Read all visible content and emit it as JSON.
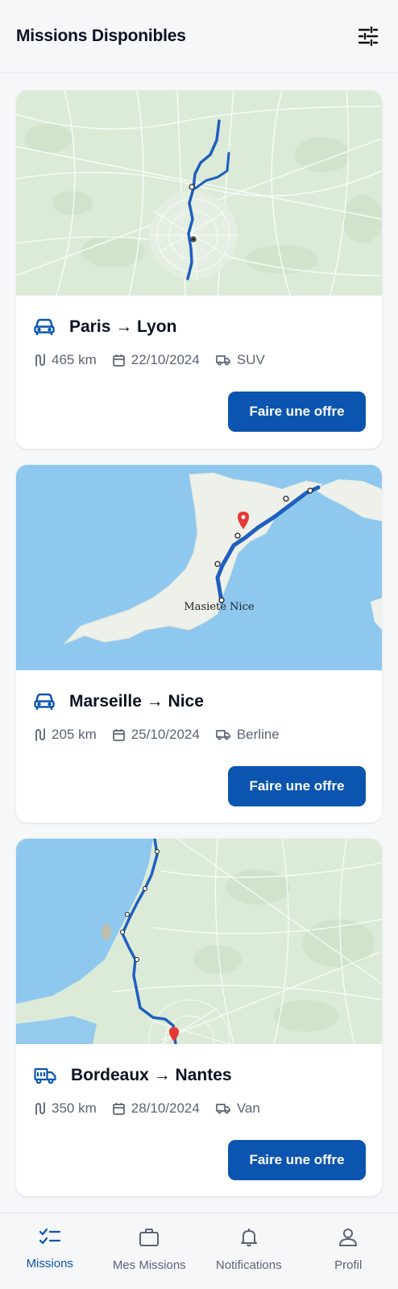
{
  "header": {
    "title": "Missions Disponibles",
    "filter_icon": "sliders-icon"
  },
  "missions": [
    {
      "route": "Paris → Lyon",
      "distance": "465 km",
      "date": "22/10/2024",
      "vehicle": "SUV",
      "vehicle_icon": "car-icon",
      "offer_label": "Faire une offre"
    },
    {
      "route": "Marseille → Nice",
      "distance": "205 km",
      "date": "25/10/2024",
      "vehicle": "Berline",
      "vehicle_icon": "car-icon",
      "offer_label": "Faire une offre",
      "map_label": "Masiete Nice"
    },
    {
      "route": "Bordeaux → Nantes",
      "distance": "350 km",
      "date": "28/10/2024",
      "vehicle": "Van",
      "vehicle_icon": "truck-icon",
      "offer_label": "Faire une offre"
    }
  ],
  "nav": [
    {
      "label": "Missions",
      "icon": "checklist-icon",
      "active": true
    },
    {
      "label": "Mes Missions",
      "icon": "briefcase-icon",
      "active": false
    },
    {
      "label": "Notifications",
      "icon": "bell-icon",
      "active": false
    },
    {
      "label": "Profil",
      "icon": "user-icon",
      "active": false
    }
  ],
  "colors": {
    "primary": "#0b55b0",
    "route": "#1f5fbf",
    "text_muted": "#5b6474",
    "land": "#dfeedd",
    "sea": "#8ec8ef"
  }
}
